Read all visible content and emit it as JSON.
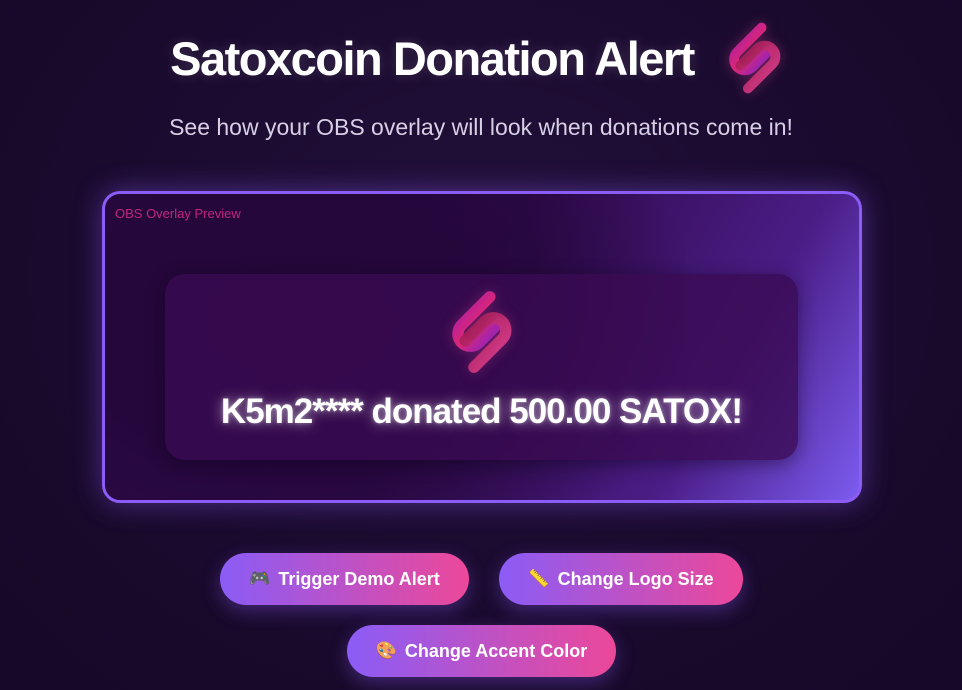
{
  "header": {
    "title": "Satoxcoin Donation Alert",
    "logo_icon": "satoxcoin-link-logo-icon"
  },
  "subtitle": "See how your OBS overlay will look when donations come in!",
  "preview": {
    "label": "OBS Overlay Preview",
    "alert": {
      "logo_icon": "satoxcoin-link-logo-icon",
      "message": "K5m2**** donated 500.00 SATOX!"
    }
  },
  "buttons": {
    "trigger": {
      "emoji": "🎮",
      "label": "Trigger Demo Alert",
      "icon": "gamepad-icon"
    },
    "logo_size": {
      "emoji": "📏",
      "label": "Change Logo Size",
      "icon": "ruler-icon"
    },
    "accent": {
      "emoji": "🎨",
      "label": "Change Accent Color",
      "icon": "palette-icon"
    }
  },
  "colors": {
    "background": "#1a0a2e",
    "accent_purple": "#8b5cf6",
    "accent_pink": "#ec4899",
    "label_pink": "#c0267e"
  }
}
